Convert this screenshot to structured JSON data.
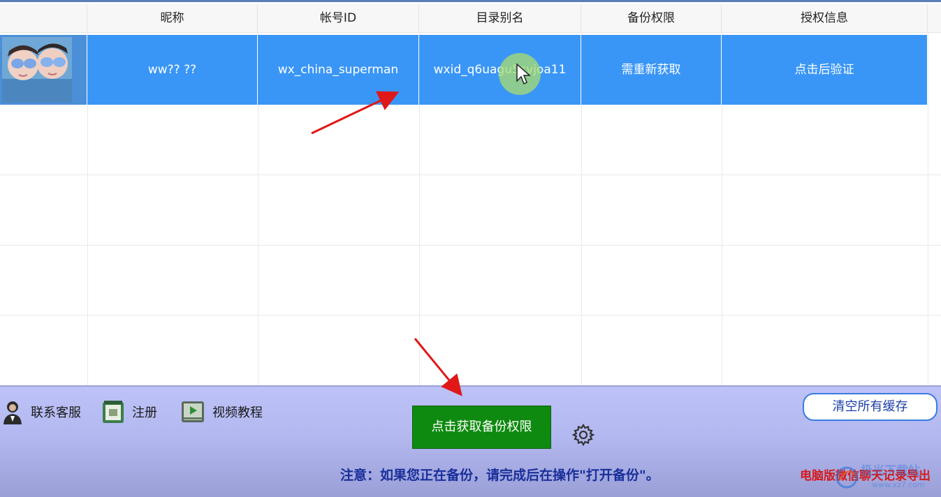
{
  "table": {
    "columns": [
      "",
      "昵称",
      "帐号ID",
      "目录别名",
      "备份权限",
      "授权信息"
    ],
    "rows": [
      {
        "nickname": "ww?? ??",
        "account_id": "wx_china_superman",
        "dir_alias": "wxid_q6uagu5cvjoa11",
        "backup_perm": "需重新获取",
        "auth_info": "点击后验证",
        "selected": true
      }
    ]
  },
  "toolbar": {
    "contact_label": "联系客服",
    "register_label": "注册",
    "video_label": "视频教程",
    "get_permission_label": "点击获取备份权限",
    "clear_cache_label": "清空所有缓存"
  },
  "notice": "注意：如果您正在备份，请完成后在操作\"打开备份\"。",
  "watermark": {
    "text": "电脑版微信聊天记录导出",
    "site_text": "极光下载站",
    "site_url": "www.xz7.com"
  },
  "colors": {
    "selected_row": "#3a96f6",
    "primary_button": "#0f8a10",
    "bottom_panel": "#b3b8f0",
    "notice_text": "#1a2f9a",
    "annotation_arrow": "#e01818"
  },
  "icons": [
    "support-agent-icon",
    "register-icon",
    "video-play-icon",
    "gear-icon",
    "mouse-cursor-icon"
  ]
}
